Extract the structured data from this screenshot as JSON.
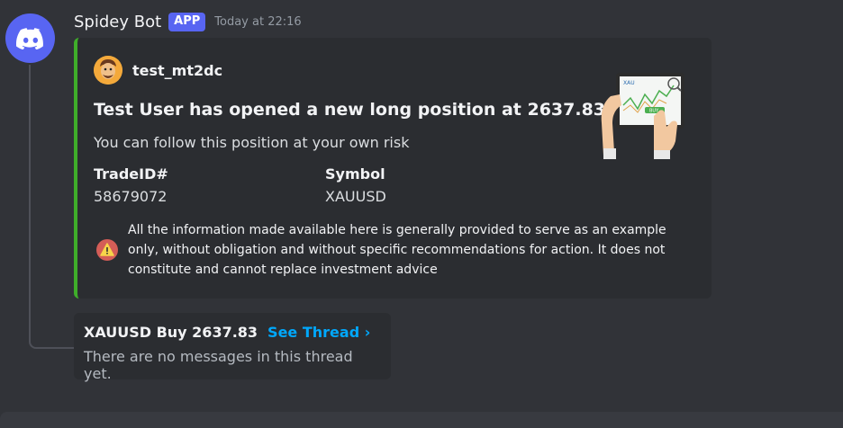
{
  "message": {
    "author": "Spidey Bot",
    "badge": "APP",
    "timestamp": "Today at 22:16"
  },
  "embed": {
    "accent_color": "#3fae2a",
    "author_name": "test_mt2dc",
    "title": "Test User has opened a new long position at 2637.83",
    "description": "You can follow this position at your own risk",
    "fields": [
      {
        "name": "TradeID#",
        "value": "58679072"
      },
      {
        "name": "Symbol",
        "value": "XAUUSD"
      }
    ],
    "warning_text": "All the information made available here is generally provided to serve as an example only, without obligation and without specific recommendations for action. It does not constitute and cannot replace investment advice",
    "thumbnail_icon": "tablet-trading-chart-icon",
    "thumbnail_label": "XAU",
    "thumbnail_button": "BUY"
  },
  "thread": {
    "name": "XAUUSD Buy 2637.83",
    "link_label": "See Thread ›",
    "empty_text": "There are no messages in this thread yet."
  },
  "colors": {
    "background": "#313338",
    "brand": "#5865f2",
    "link": "#00a8fc"
  }
}
